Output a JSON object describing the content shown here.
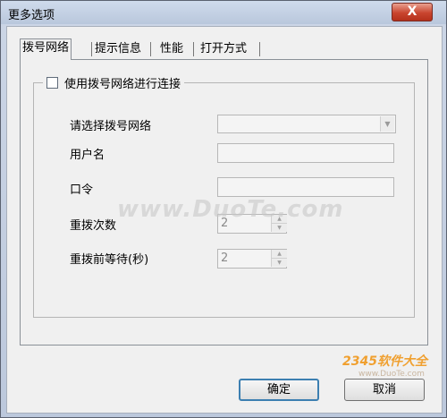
{
  "window": {
    "title": "更多选项",
    "close_glyph": "X"
  },
  "tabs": [
    {
      "label": "拨号网络",
      "active": true
    },
    {
      "label": "提示信息",
      "active": false
    },
    {
      "label": "性能",
      "active": false
    },
    {
      "label": "打开方式",
      "active": false
    }
  ],
  "group": {
    "checkbox_label": "使用拨号网络进行连接",
    "checked": false
  },
  "fields": {
    "network_label": "请选择拨号网络",
    "network_value": "",
    "username_label": "用户名",
    "username_value": "",
    "password_label": "口令",
    "password_value": "",
    "redial_count_label": "重拨次数",
    "redial_count_value": "2",
    "redial_wait_label": "重拨前等待(秒)",
    "redial_wait_value": "2"
  },
  "buttons": {
    "ok": "确定",
    "cancel": "取消"
  },
  "watermarks": {
    "center": "www.DuoTe.com",
    "corner_title": "2345软件大全",
    "corner_url": "www.DuoTe.com"
  }
}
